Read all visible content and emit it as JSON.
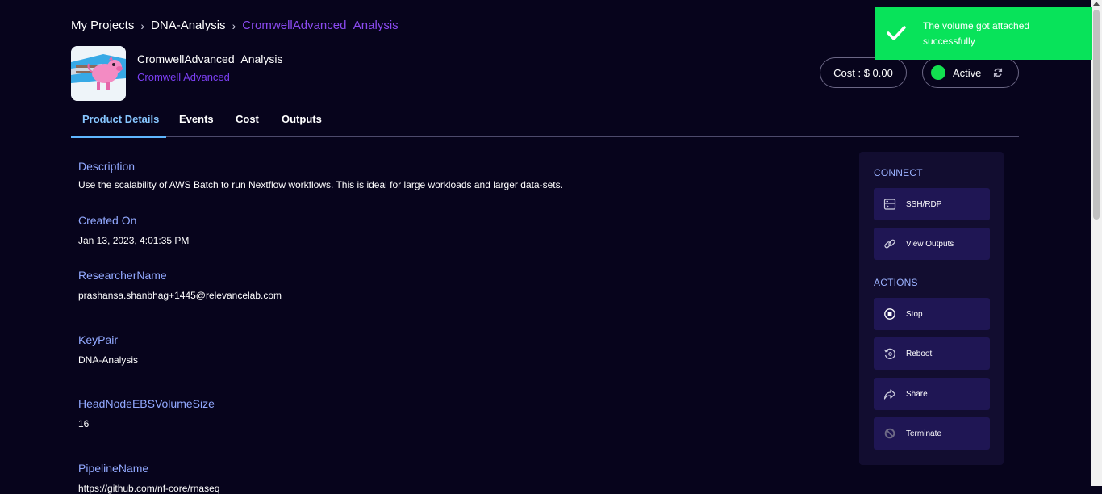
{
  "breadcrumb": {
    "items": [
      "My Projects",
      "DNA-Analysis",
      "CromwellAdvanced_Analysis"
    ],
    "separator": "›"
  },
  "product": {
    "title": "CromwellAdvanced_Analysis",
    "subtitle": "Cromwell Advanced",
    "logo_icon": "pig-logo-icon"
  },
  "header": {
    "cost_label": "Cost : $ 0.00",
    "status_label": "Active",
    "status_color": "#12e04f"
  },
  "toast": {
    "message": "The volume got attached successfully",
    "color": "#08e35a",
    "icon": "check-icon"
  },
  "tabs": [
    {
      "label": "Product Details",
      "active": true
    },
    {
      "label": "Events",
      "active": false
    },
    {
      "label": "Cost",
      "active": false
    },
    {
      "label": "Outputs",
      "active": false
    }
  ],
  "details": [
    {
      "label": "Description",
      "value": "Use the scalability of AWS Batch to run Nextflow workflows. This is ideal for large workloads and larger data-sets."
    },
    {
      "label": "Created On",
      "value": "Jan 13, 2023, 4:01:35 PM"
    },
    {
      "label": "ResearcherName",
      "value": "prashansa.shanbhag+1445@relevancelab.com"
    },
    {
      "label": "KeyPair",
      "value": "DNA-Analysis"
    },
    {
      "label": "HeadNodeEBSVolumeSize",
      "value": "16"
    },
    {
      "label": "PipelineName",
      "value": "https://github.com/nf-core/rnaseq"
    }
  ],
  "sidebar": {
    "connect_title": "CONNECT",
    "connect": [
      {
        "label": "SSH/RDP",
        "icon": "terminal-icon"
      },
      {
        "label": "View Outputs",
        "icon": "link-icon"
      }
    ],
    "actions_title": "ACTIONS",
    "actions": [
      {
        "label": "Stop",
        "icon": "stop-icon"
      },
      {
        "label": "Reboot",
        "icon": "reboot-icon"
      },
      {
        "label": "Share",
        "icon": "share-icon"
      },
      {
        "label": "Terminate",
        "icon": "terminate-icon"
      }
    ]
  }
}
